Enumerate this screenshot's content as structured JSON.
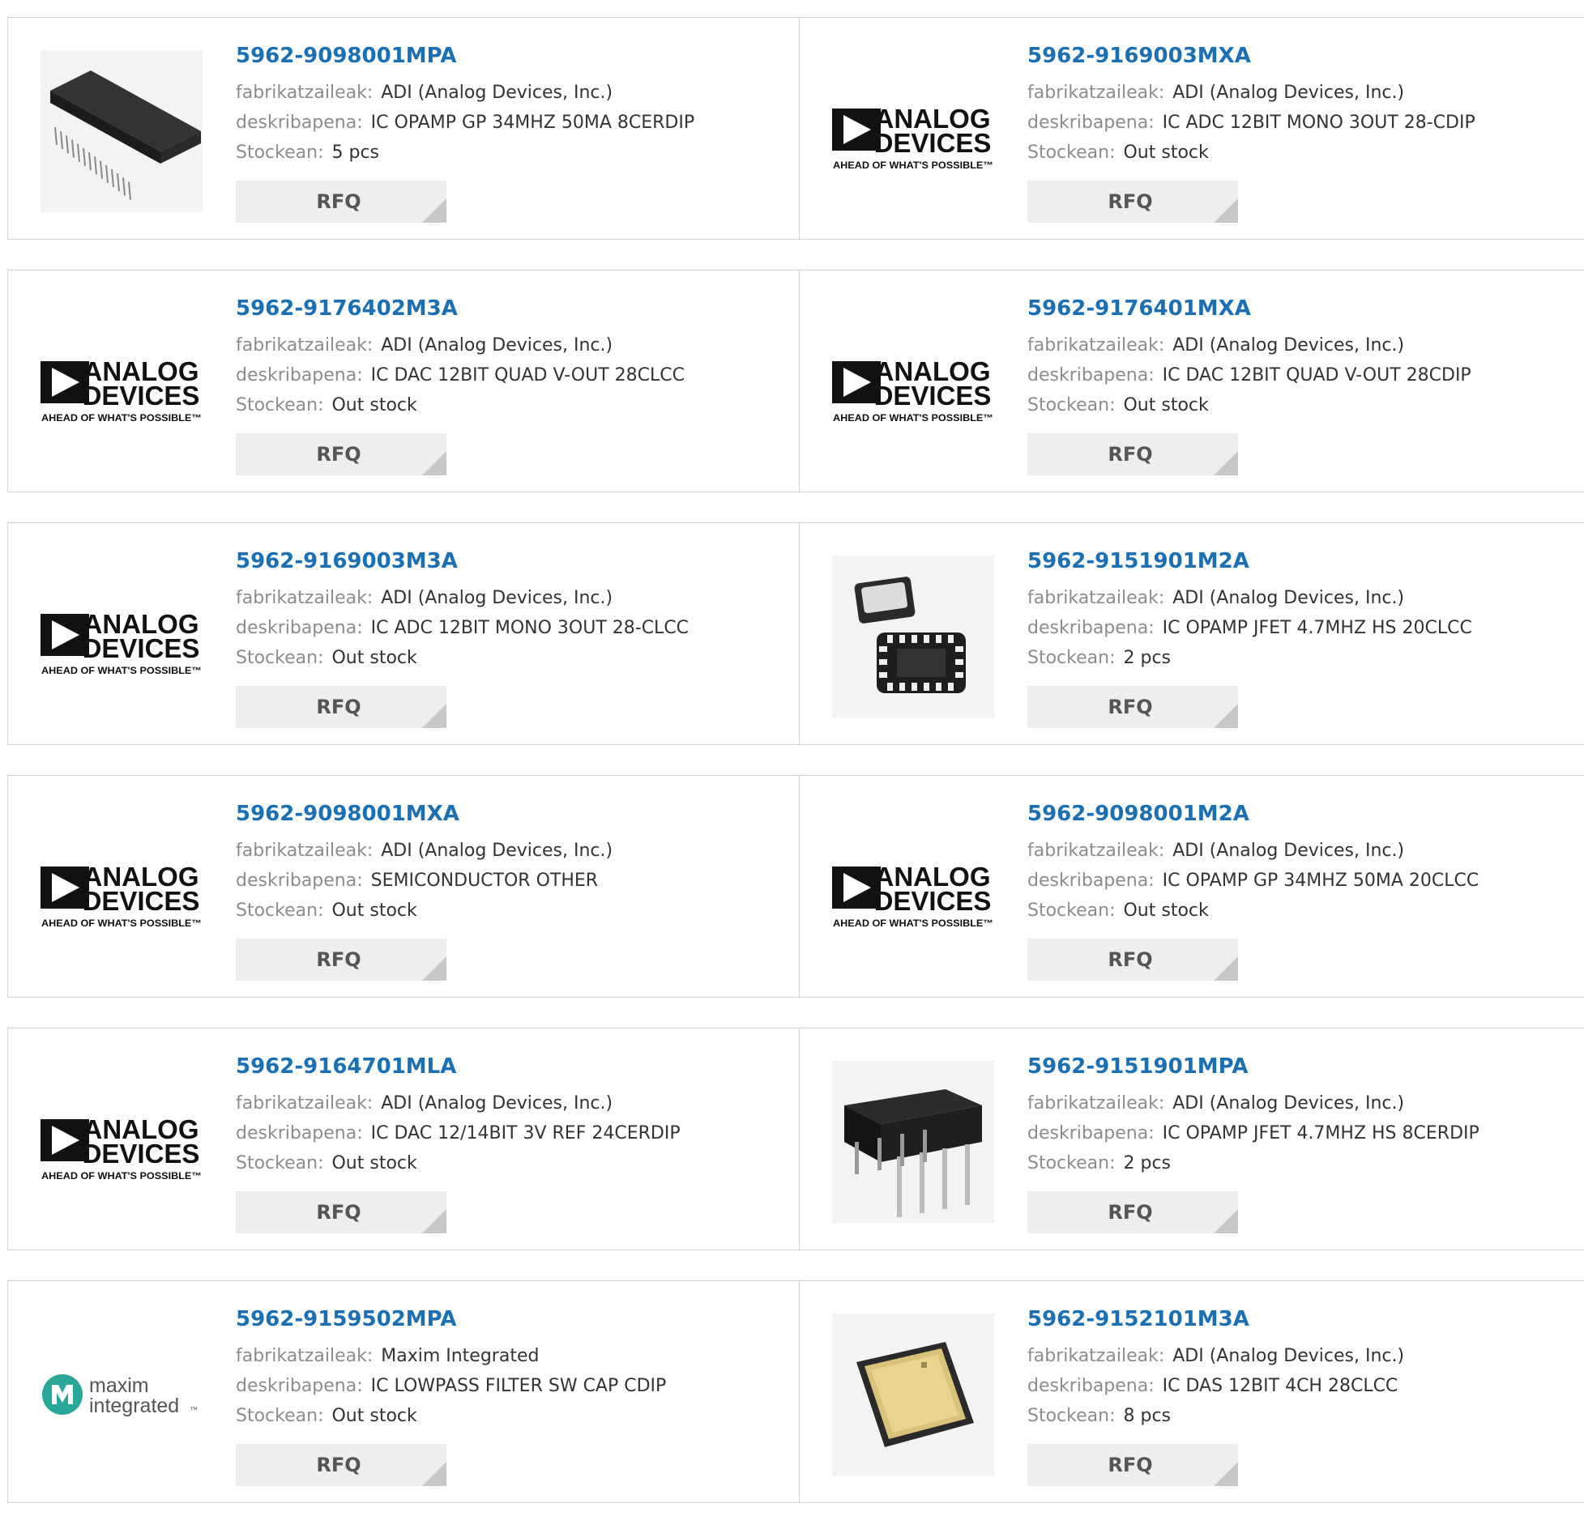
{
  "labels": {
    "manufacturer": "fabrikatzaileak:",
    "description": "deskribapena:",
    "stock": "Stockean:",
    "rfq": "RFQ"
  },
  "logo_text": {
    "analog_line1": "ANALOG",
    "analog_line2": "DEVICES",
    "analog_tagline": "AHEAD OF WHAT'S POSSIBLE™",
    "maxim_line1": "maxim",
    "maxim_line2": "integrated",
    "maxim_tm": "™"
  },
  "colors": {
    "link": "#1a6fb5",
    "label": "#8c8c8c",
    "rfq_bg": "#eeeeee",
    "maxim_teal": "#29a89a"
  },
  "products": [
    {
      "part": "5962-9098001MPA",
      "manufacturer": "ADI (Analog Devices, Inc.)",
      "description": "IC OPAMP GP 34MHZ 50MA 8CERDIP",
      "stock": "5 pcs",
      "image": "dip-28-chip-photo"
    },
    {
      "part": "5962-9169003MXA",
      "manufacturer": "ADI (Analog Devices, Inc.)",
      "description": "IC ADC 12BIT MONO 3OUT 28-CDIP",
      "stock": "Out stock",
      "image": "analog-devices-logo"
    },
    {
      "part": "5962-9176402M3A",
      "manufacturer": "ADI (Analog Devices, Inc.)",
      "description": "IC DAC 12BIT QUAD V-OUT 28CLCC",
      "stock": "Out stock",
      "image": "analog-devices-logo"
    },
    {
      "part": "5962-9176401MXA",
      "manufacturer": "ADI (Analog Devices, Inc.)",
      "description": "IC DAC 12BIT QUAD V-OUT 28CDIP",
      "stock": "Out stock",
      "image": "analog-devices-logo"
    },
    {
      "part": "5962-9169003M3A",
      "manufacturer": "ADI (Analog Devices, Inc.)",
      "description": "IC ADC 12BIT MONO 3OUT 28-CLCC",
      "stock": "Out stock",
      "image": "analog-devices-logo"
    },
    {
      "part": "5962-9151901M2A",
      "manufacturer": "ADI (Analog Devices, Inc.)",
      "description": "IC OPAMP JFET 4.7MHZ HS 20CLCC",
      "stock": "2 pcs",
      "image": "clcc-chip-photo"
    },
    {
      "part": "5962-9098001MXA",
      "manufacturer": "ADI (Analog Devices, Inc.)",
      "description": "SEMICONDUCTOR OTHER",
      "stock": "Out stock",
      "image": "analog-devices-logo"
    },
    {
      "part": "5962-9098001M2A",
      "manufacturer": "ADI (Analog Devices, Inc.)",
      "description": "IC OPAMP GP 34MHZ 50MA 20CLCC",
      "stock": "Out stock",
      "image": "analog-devices-logo"
    },
    {
      "part": "5962-9164701MLA",
      "manufacturer": "ADI (Analog Devices, Inc.)",
      "description": "IC DAC 12/14BIT 3V REF 24CERDIP",
      "stock": "Out stock",
      "image": "analog-devices-logo"
    },
    {
      "part": "5962-9151901MPA",
      "manufacturer": "ADI (Analog Devices, Inc.)",
      "description": "IC OPAMP JFET 4.7MHZ HS 8CERDIP",
      "stock": "2 pcs",
      "image": "cerdip-8-chip-photo"
    },
    {
      "part": "5962-9159502MPA",
      "manufacturer": "Maxim Integrated",
      "description": "IC LOWPASS FILTER SW CAP CDIP",
      "stock": "Out stock",
      "image": "maxim-integrated-logo"
    },
    {
      "part": "5962-9152101M3A",
      "manufacturer": "ADI (Analog Devices, Inc.)",
      "description": "IC DAS 12BIT 4CH 28CLCC",
      "stock": "8 pcs",
      "image": "gold-lid-chip-photo"
    }
  ]
}
